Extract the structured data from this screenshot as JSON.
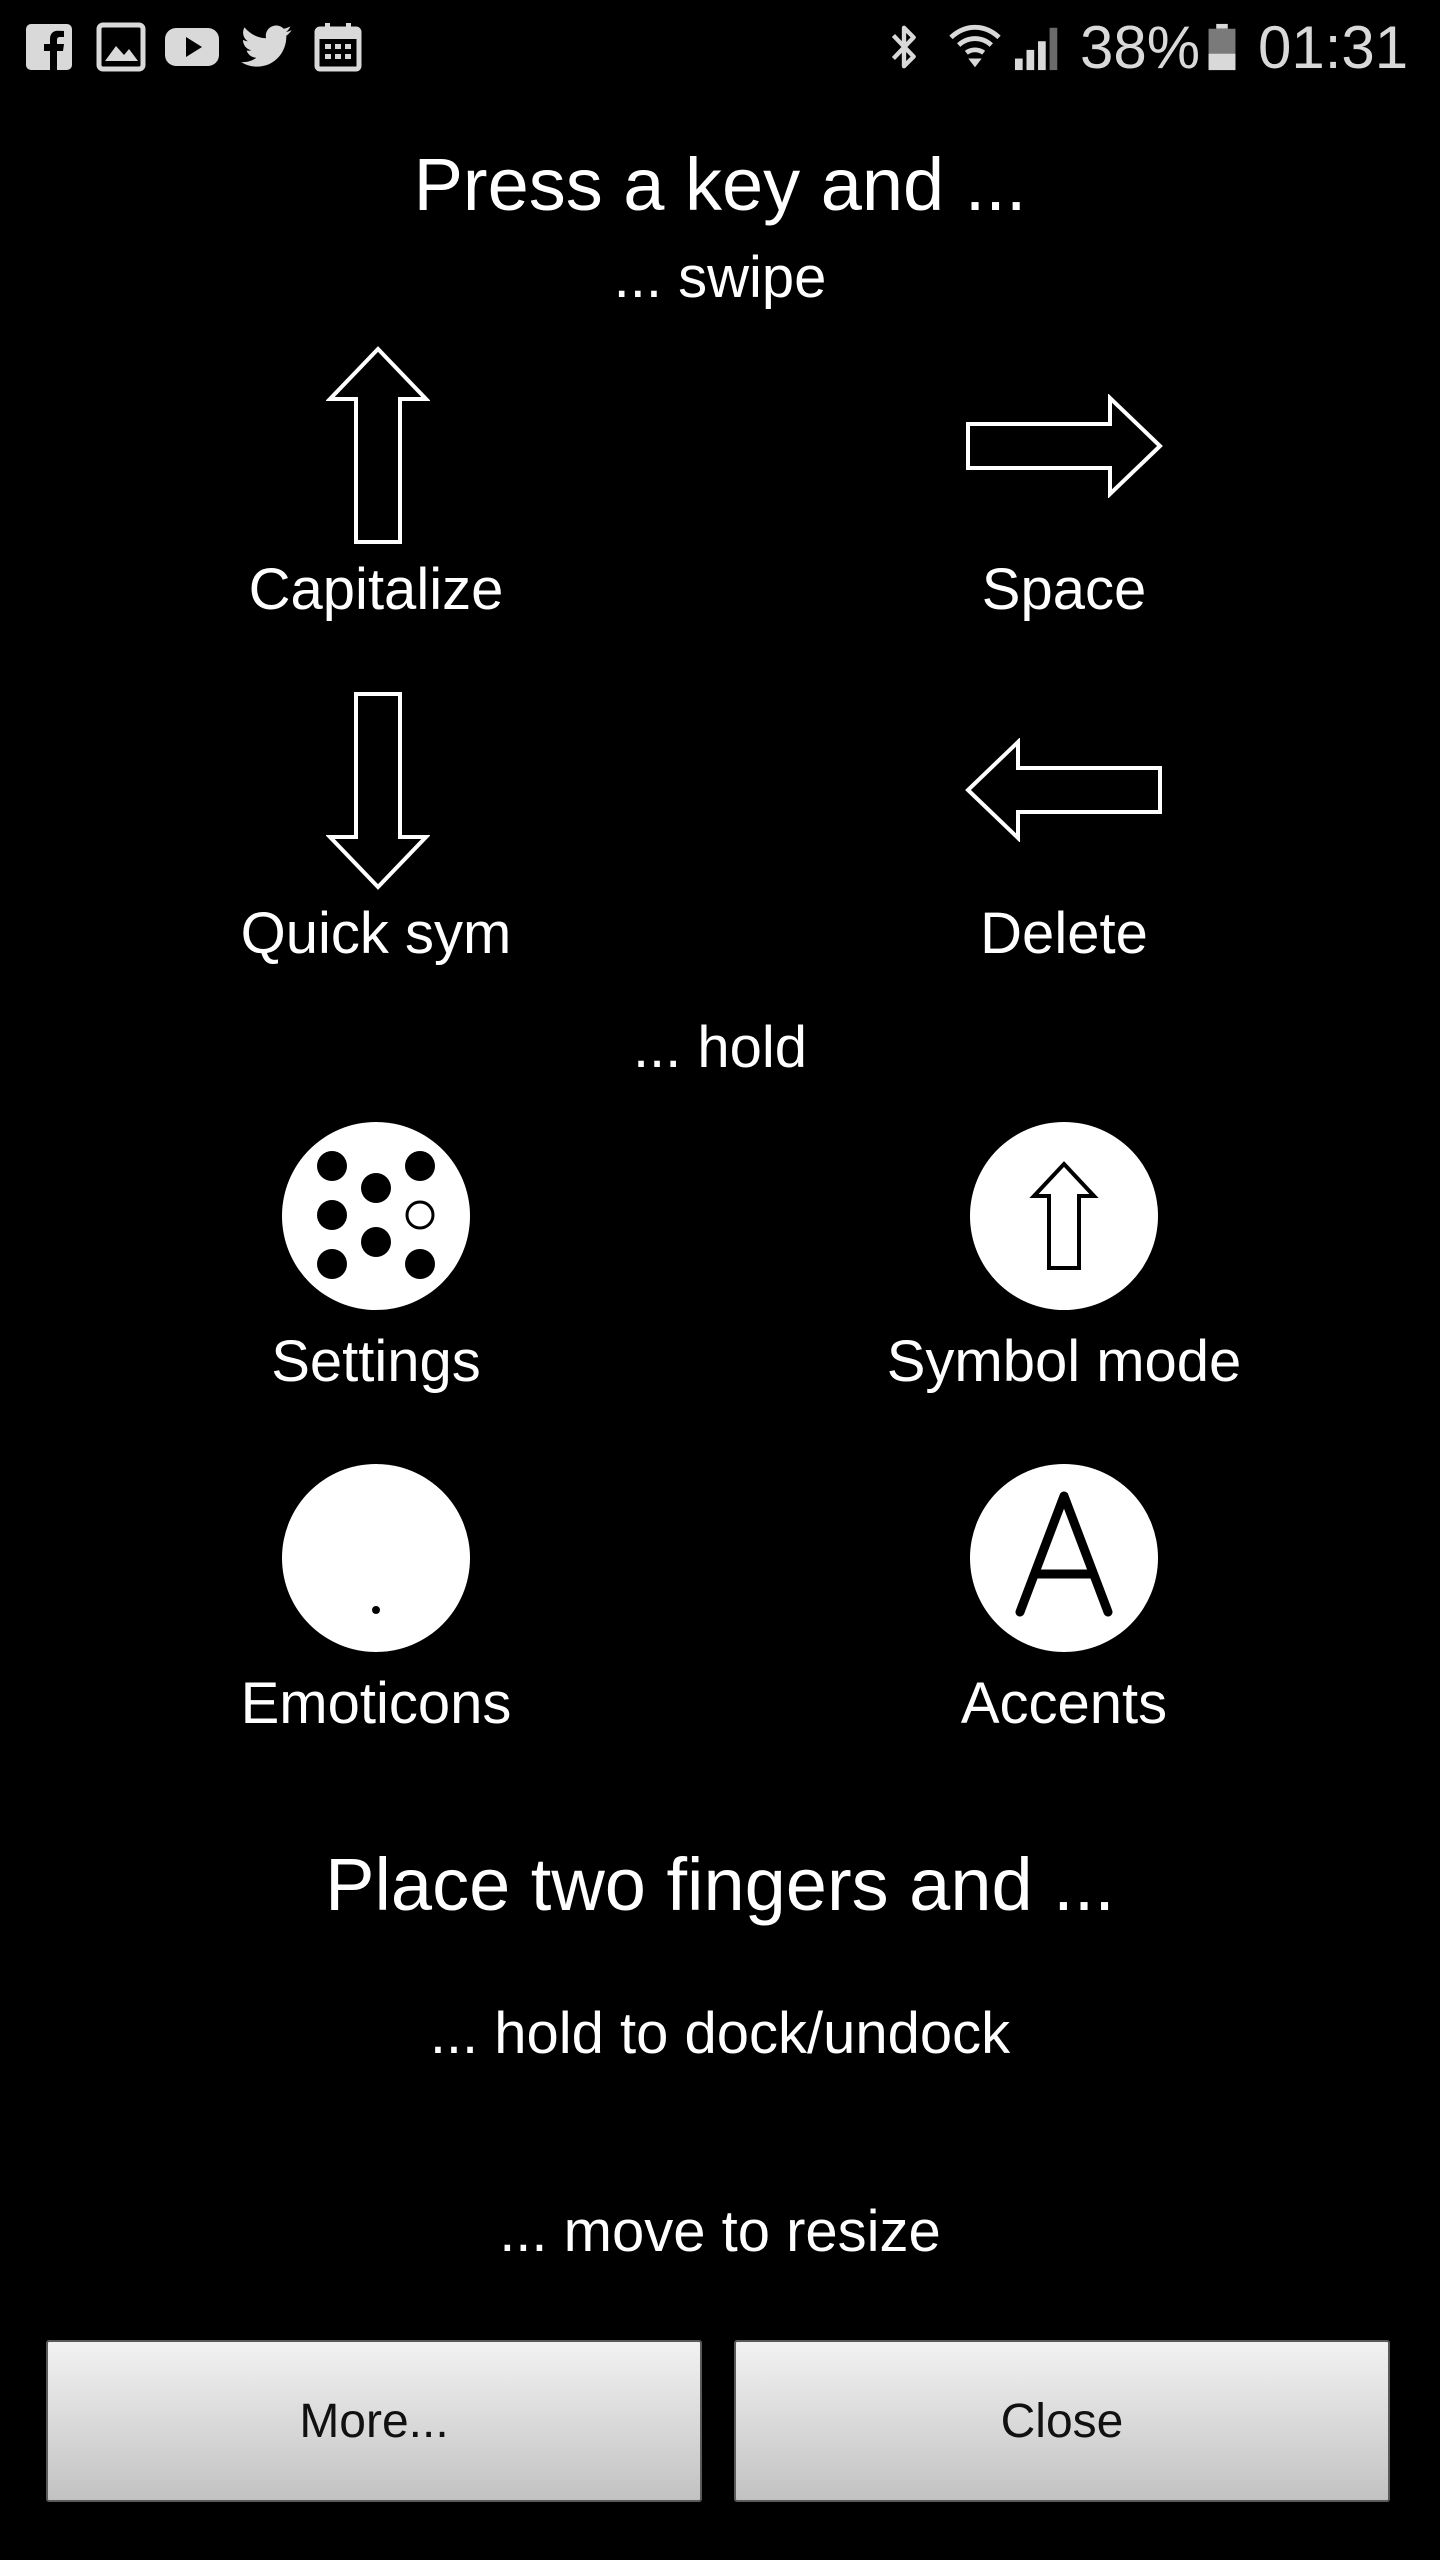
{
  "status_bar": {
    "notification_icons": [
      "facebook-icon",
      "gallery-icon",
      "youtube-icon",
      "twitter-icon",
      "calendar-icon"
    ],
    "system_icons": [
      "bluetooth-icon",
      "wifi-icon",
      "signal-icon",
      "battery-icon"
    ],
    "battery": "38%",
    "time": "01:31"
  },
  "tutorial": {
    "title": "Press a key and ...",
    "swipe_heading": "... swipe",
    "swipe_items": [
      {
        "label": "Capitalize",
        "icon": "arrow-up-icon"
      },
      {
        "label": "Space",
        "icon": "arrow-right-icon"
      },
      {
        "label": "Quick sym",
        "icon": "arrow-down-icon"
      },
      {
        "label": "Delete",
        "icon": "arrow-left-icon"
      }
    ],
    "hold_heading": "... hold",
    "hold_items": [
      {
        "label": "Settings",
        "icon": "dots-icon"
      },
      {
        "label": "Symbol mode",
        "icon": "shift-icon"
      },
      {
        "label": "Emoticons",
        "icon": "emoticon-dot-icon"
      },
      {
        "label": "Accents",
        "icon": "letter-a-icon",
        "glyph": "A"
      }
    ],
    "two_fingers_title": "Place two fingers and ...",
    "dock_text": "... hold to dock/undock",
    "resize_text": "... move to resize"
  },
  "buttons": {
    "more": "More...",
    "close": "Close"
  },
  "colors": {
    "background": "#000000",
    "foreground": "#ffffff",
    "button_top": "#f2f2f2",
    "button_bottom": "#c2c2c2"
  }
}
